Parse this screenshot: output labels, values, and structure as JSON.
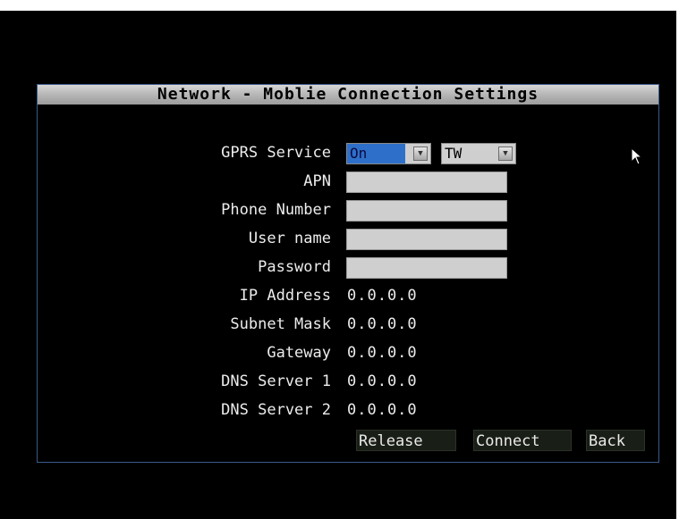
{
  "window": {
    "title": "Network - Moblie Connection Settings"
  },
  "fields": {
    "gprs_service": {
      "label": "GPRS Service",
      "value": "On",
      "region": "TW"
    },
    "apn": {
      "label": "APN",
      "value": ""
    },
    "phone_number": {
      "label": "Phone Number",
      "value": ""
    },
    "user_name": {
      "label": "User name",
      "value": ""
    },
    "password": {
      "label": "Password",
      "value": ""
    },
    "ip_address": {
      "label": "IP Address",
      "value": "0.0.0.0"
    },
    "subnet_mask": {
      "label": "Subnet Mask",
      "value": "0.0.0.0"
    },
    "gateway": {
      "label": "Gateway",
      "value": "0.0.0.0"
    },
    "dns_server_1": {
      "label": "DNS Server 1",
      "value": "0.0.0.0"
    },
    "dns_server_2": {
      "label": "DNS Server 2",
      "value": "0.0.0.0"
    }
  },
  "buttons": {
    "release": "Release",
    "connect": "Connect",
    "back": "Back"
  },
  "icons": {
    "dropdown": "chevron-down-icon",
    "cursor": "mouse-pointer-icon"
  },
  "colors": {
    "background": "#000000",
    "text": "#ececec",
    "titlebar": "#b9b9b9",
    "selection": "#2e70c9",
    "input": "#cfcfcf",
    "window_border": "#3a5a8a"
  }
}
